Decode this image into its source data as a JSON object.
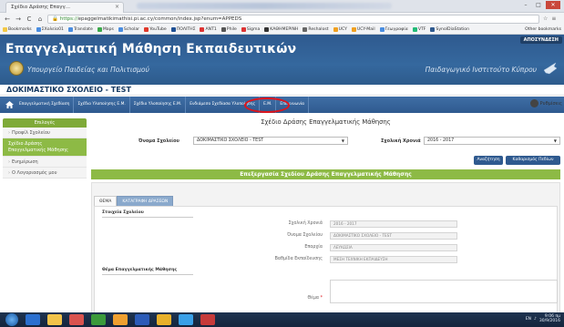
{
  "browser": {
    "tab_title": "Σχέδιο Δράσης Επαγγ...",
    "tab_close": "×",
    "nav_back": "←",
    "nav_forward": "→",
    "nav_reload": "C",
    "nav_home": "⌂",
    "url_scheme": "https://",
    "url_rest": "epaggelmatikimathisi.pi.ac.cy/common/index.jsp?enum=APPEDS",
    "bookmarks": [
      {
        "label": "Bookmarks",
        "color": "#f3c846"
      },
      {
        "label": "ΣΧολείο01",
        "color": "#4a8de0"
      },
      {
        "label": "Translate",
        "color": "#4a8de0"
      },
      {
        "label": "Maps",
        "color": "#3ca94b"
      },
      {
        "label": "Scholar",
        "color": "#4a8de0"
      },
      {
        "label": "YouTube",
        "color": "#e0392b"
      },
      {
        "label": "ΠΟΛΙΤΗΣ",
        "color": "#1e4f93"
      },
      {
        "label": "ΑΝΤ1",
        "color": "#d33"
      },
      {
        "label": "Phile",
        "color": "#555"
      },
      {
        "label": "Sigma",
        "color": "#d33"
      },
      {
        "label": "ΚΑΘΗΜΕΡΙΝΗ",
        "color": "#333"
      },
      {
        "label": "Reshalost",
        "color": "#666"
      },
      {
        "label": "UCY",
        "color": "#f0a020"
      },
      {
        "label": "UCY-Mail",
        "color": "#f0a020"
      },
      {
        "label": "Γεωγραφία",
        "color": "#4a8de0"
      },
      {
        "label": "VTF",
        "color": "#2b7"
      },
      {
        "label": "SynolDiaStation",
        "color": "#2f5a8f"
      }
    ],
    "other_bookmarks": "Other bookmarks"
  },
  "header": {
    "title": "Επαγγελματική Μάθηση Εκπαιδευτικών",
    "ministry": "Υπουργείο Παιδείας και Πολιτισμού",
    "institute": "Παιδαγωγικό Ινστιτούτο Κύπρου",
    "logout": "ΑΠΟΣΥΝΔΕΣΗ",
    "school": "ΔΟΚΙΜΑΣΤΙΚΟ ΣΧΟΛΕΙΟ - TEST"
  },
  "nav": {
    "items": [
      "Επαγγελματική Σχεδίαση",
      "Σχέδιο Υλοποίησης Ε.Μ.",
      "Σχέδιο Υλοποίησης Ε.Μ.",
      "Ενδιάμεσο Σχεδίασα Υλοποίησης",
      "Ε.Μ.",
      "Επικοινωνία"
    ],
    "user": "Ρυθμίσεις"
  },
  "sidebar": {
    "header": "Επιλογές",
    "items": [
      {
        "label": "Προφίλ Σχολείου",
        "active": false
      },
      {
        "label": "Σχέδιο Δράσης",
        "label2": "Επαγγελματικής Μάθησης",
        "active": true
      },
      {
        "label": "Ενημέρωση",
        "active": false
      },
      {
        "label": "Ο Λογαριασμός μου",
        "active": false
      }
    ]
  },
  "main": {
    "plan_title": "Σχέδιο Δράσης Επαγγελματικής Μάθησης",
    "school_label": "Όνομα Σχολείου",
    "school_value": "ΔΟΚΙΜΑΣΤΙΚΟ ΣΧΟΛΕΙΟ - TEST",
    "year_label": "Σχολική Χρονιά",
    "year_value": "2016 - 2017",
    "search_button": "Αναζήτηση",
    "clear_button": "Καθαρισμός Πεδίων",
    "edit_title": "Επεξεργασία Σχεδίου Δράσης Επαγγελματικής Μάθησης",
    "tabs": [
      "ΘΕΜΑ",
      "ΚΑΤΑΓΡΑΦΗ ΔΡΑΣΕΩΝ"
    ],
    "school_section": "Στοιχεία Σχολείου",
    "fields": [
      {
        "label": "Σχολική Χρονιά",
        "value": "2016 - 2017"
      },
      {
        "label": "Όνομα Σχολείου",
        "value": "ΔΟΚΙΜΑΣΤΙΚΟ ΣΧΟΛΕΙΟ - TEST"
      },
      {
        "label": "Επαρχία",
        "value": "ΛΕΥΚΩΣΙΑ"
      },
      {
        "label": "Βαθμίδα Εκπαίδευσης",
        "value": "ΜΕΣΗ ΤΕΧΝΙΚΗ ΕΚΠΑΙΔΕΥΣΗ"
      }
    ],
    "topic_section": "Θέμα Επαγγελματικής Μάθησης",
    "topic_label": "Θέμα",
    "required_mark": "*"
  },
  "taskbar": {
    "lang": "EN",
    "time": "9:06 πμ",
    "date": "30/9/2016"
  },
  "colors": {
    "header_blue": "#2f5a8f",
    "accent_green": "#8dba45",
    "highlight_red": "#e0141b"
  }
}
